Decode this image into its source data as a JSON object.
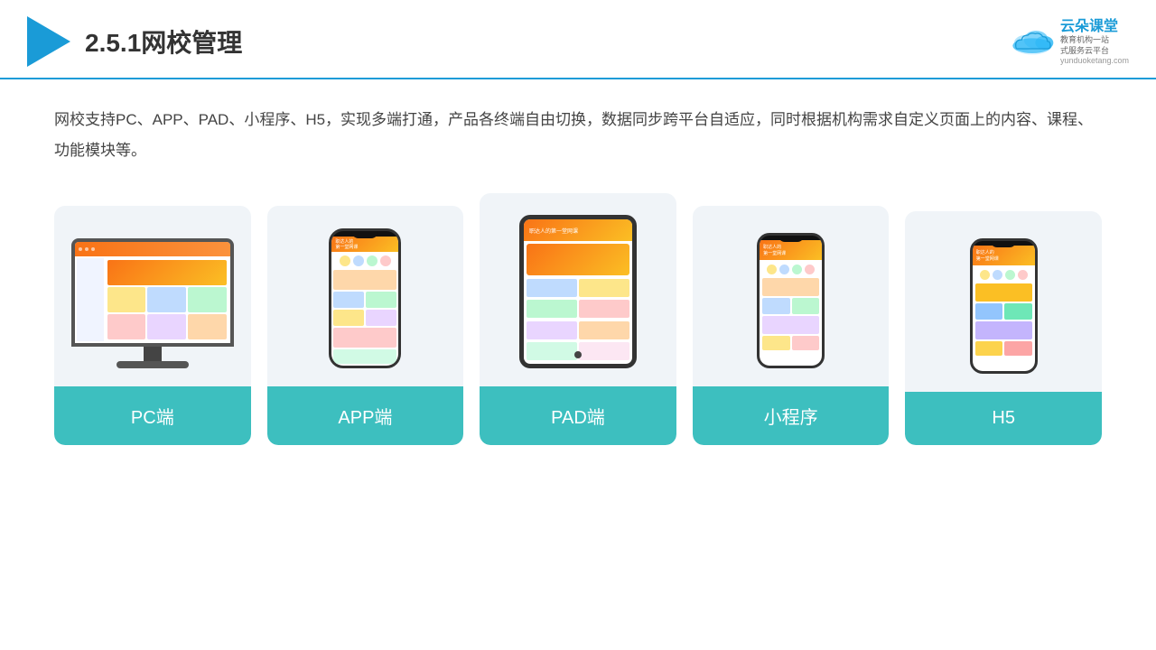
{
  "header": {
    "title": "2.5.1网校管理",
    "brand": {
      "name": "云朵课堂",
      "tagline": "教育机构一站\n式服务云平台",
      "url": "yunduoketang.com"
    }
  },
  "description": "网校支持PC、APP、PAD、小程序、H5，实现多端打通，产品各终端自由切换，数据同步跨平台自适应，同时根据机构需求自定义页面上的内容、课程、功能模块等。",
  "cards": [
    {
      "id": "pc",
      "label": "PC端"
    },
    {
      "id": "app",
      "label": "APP端"
    },
    {
      "id": "pad",
      "label": "PAD端"
    },
    {
      "id": "miniapp",
      "label": "小程序"
    },
    {
      "id": "h5",
      "label": "H5"
    }
  ]
}
